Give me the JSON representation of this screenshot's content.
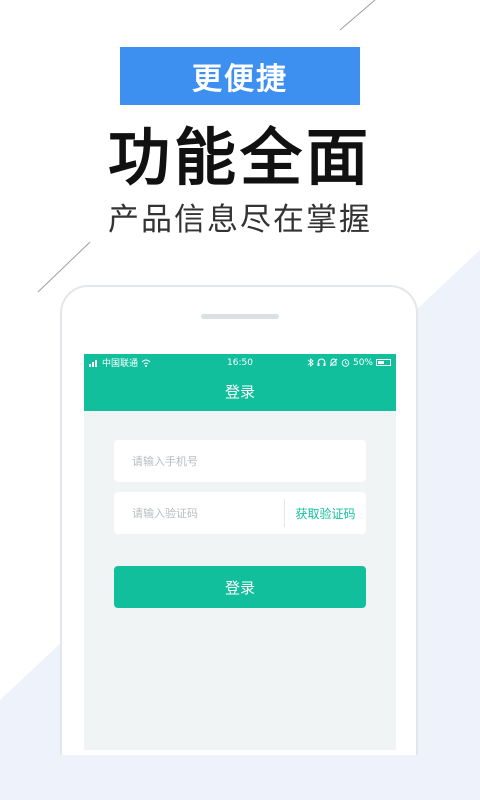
{
  "promo": {
    "badge": "更便捷",
    "headline": "功能全面",
    "subline": "产品信息尽在掌握"
  },
  "statusbar": {
    "carrier": "中国联通",
    "time": "16:50",
    "battery": "50%",
    "battery_level": 0.5
  },
  "app": {
    "title": "登录",
    "phone_placeholder": "请输入手机号",
    "code_placeholder": "请输入验证码",
    "get_code_label": "获取验证码",
    "login_label": "登录"
  },
  "colors": {
    "accent": "#12bf9c",
    "badge": "#3d8ff0",
    "background_tint": "#eef2fb"
  }
}
